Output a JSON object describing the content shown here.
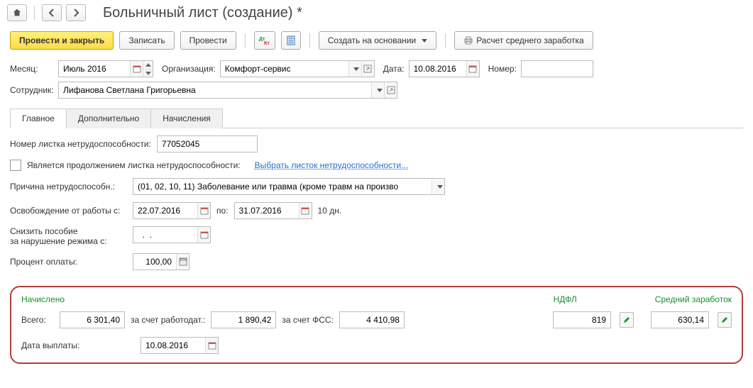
{
  "title": "Больничный лист (создание) *",
  "toolbar": {
    "post_close": "Провести и закрыть",
    "save": "Записать",
    "post": "Провести",
    "create_based": "Создать на основании",
    "avg_calc": "Расчет среднего заработка"
  },
  "header": {
    "month_label": "Месяц:",
    "month": "Июль 2016",
    "org_label": "Организация:",
    "org": "Комфорт-сервис",
    "date_label": "Дата:",
    "date": "10.08.2016",
    "number_label": "Номер:",
    "number": "",
    "employee_label": "Сотрудник:",
    "employee": "Лифанова Светлана Григорьевна"
  },
  "tabs": {
    "main": "Главное",
    "extra": "Дополнительно",
    "accruals": "Начисления"
  },
  "form": {
    "sheet_no_label": "Номер листка нетрудоспособности:",
    "sheet_no": "77052045",
    "continuation_label": "Является продолжением листка нетрудоспособности:",
    "choose_sheet": "Выбрать листок нетрудоспособности...",
    "reason_label": "Причина нетрудоспособн.:",
    "reason": "(01, 02, 10, 11) Заболевание или травма (кроме травм на произво",
    "absence_label": "Освобождение от работы с:",
    "absence_from": "22.07.2016",
    "to_label": "по:",
    "absence_to": "31.07.2016",
    "days": "10 дн.",
    "reduce_label_1": "Снизить пособие",
    "reduce_label_2": "за нарушение режима с:",
    "reduce_date": "  .  .",
    "percent_label": "Процент оплаты:",
    "percent": "100,00"
  },
  "calc": {
    "accrued": "Начислено",
    "ndfl": "НДФЛ",
    "avg": "Средний заработок",
    "total_label": "Всего:",
    "total": "6 301,40",
    "employer_label": "за счет работодат.:",
    "employer": "1 890,42",
    "fss_label": "за счет ФСС:",
    "fss": "4 410,98",
    "ndfl_val": "819",
    "avg_val": "630,14",
    "paydate_label": "Дата выплаты:",
    "paydate": "10.08.2016"
  }
}
